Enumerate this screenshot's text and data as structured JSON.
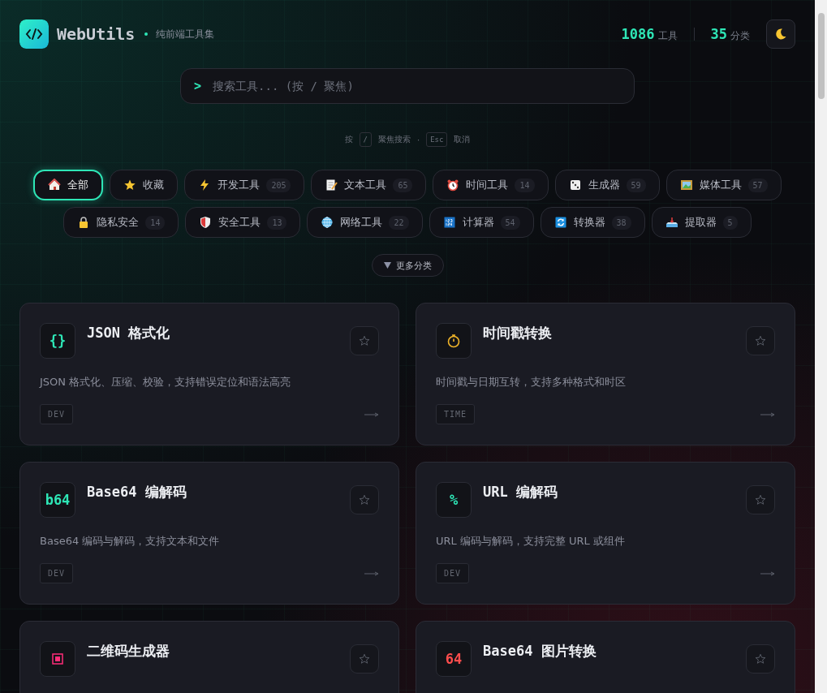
{
  "header": {
    "title": "WebUtils",
    "subtitle": "纯前端工具集",
    "stats": [
      {
        "value": "1086",
        "label": "工具"
      },
      {
        "value": "35",
        "label": "分类"
      }
    ]
  },
  "search": {
    "prompt": ">",
    "placeholder": "搜索工具... (按 / 聚焦)"
  },
  "hint": [
    {
      "kind": "text",
      "text": "按"
    },
    {
      "kind": "key",
      "text": "/"
    },
    {
      "kind": "text",
      "text": "聚焦搜索"
    },
    {
      "kind": "text",
      "text": "·"
    },
    {
      "kind": "key",
      "text": "Esc"
    },
    {
      "kind": "text",
      "text": "取消"
    }
  ],
  "category_rows": [
    [
      {
        "label": "全部",
        "selected": true
      },
      {
        "label": "收藏",
        "selected": false
      },
      {
        "label": "开发工具",
        "count": "205",
        "selected": false
      },
      {
        "label": "文本工具",
        "count": "65",
        "selected": false
      },
      {
        "label": "时间工具",
        "count": "14",
        "selected": false
      },
      {
        "label": "生成器",
        "count": "59",
        "selected": false
      },
      {
        "label": "媒体工具",
        "count": "57",
        "selected": false
      }
    ],
    [
      {
        "label": "隐私安全",
        "count": "14",
        "selected": false
      },
      {
        "label": "安全工具",
        "count": "13",
        "selected": false
      },
      {
        "label": "网络工具",
        "count": "22",
        "selected": false
      },
      {
        "label": "计算器",
        "count": "54",
        "selected": false
      },
      {
        "label": "转换器",
        "count": "38",
        "selected": false
      },
      {
        "label": "提取器",
        "count": "5",
        "selected": false
      }
    ]
  ],
  "more_button": {
    "label": "更多分类"
  },
  "tools": [
    {
      "icon": {
        "kind": "text",
        "text": "{}",
        "color": "#2ee6b6"
      },
      "title": "JSON 格式化",
      "description": "JSON 格式化、压缩、校验，支持错误定位和语法高亮",
      "tag": "DEV"
    },
    {
      "icon": {
        "kind": "stopwatch",
        "color": "#f0b429"
      },
      "title": "时间戳转换",
      "description": "时间戳与日期互转，支持多种格式和时区",
      "tag": "TIME"
    },
    {
      "icon": {
        "kind": "text",
        "text": "b64",
        "color": "#2ee6b6"
      },
      "title": "Base64 编解码",
      "description": "Base64 编码与解码，支持文本和文件",
      "tag": "DEV"
    },
    {
      "icon": {
        "kind": "text",
        "text": "%",
        "color": "#2ee6b6"
      },
      "title": "URL 编解码",
      "description": "URL 编码与解码，支持完整 URL 或组件",
      "tag": "DEV"
    },
    {
      "icon": {
        "kind": "square",
        "color": "#ff2d78"
      },
      "title": "二维码生成器"
    },
    {
      "icon": {
        "kind": "text",
        "text": "64",
        "color": "#ff4d4d"
      },
      "title": "Base64 图片转换"
    }
  ]
}
